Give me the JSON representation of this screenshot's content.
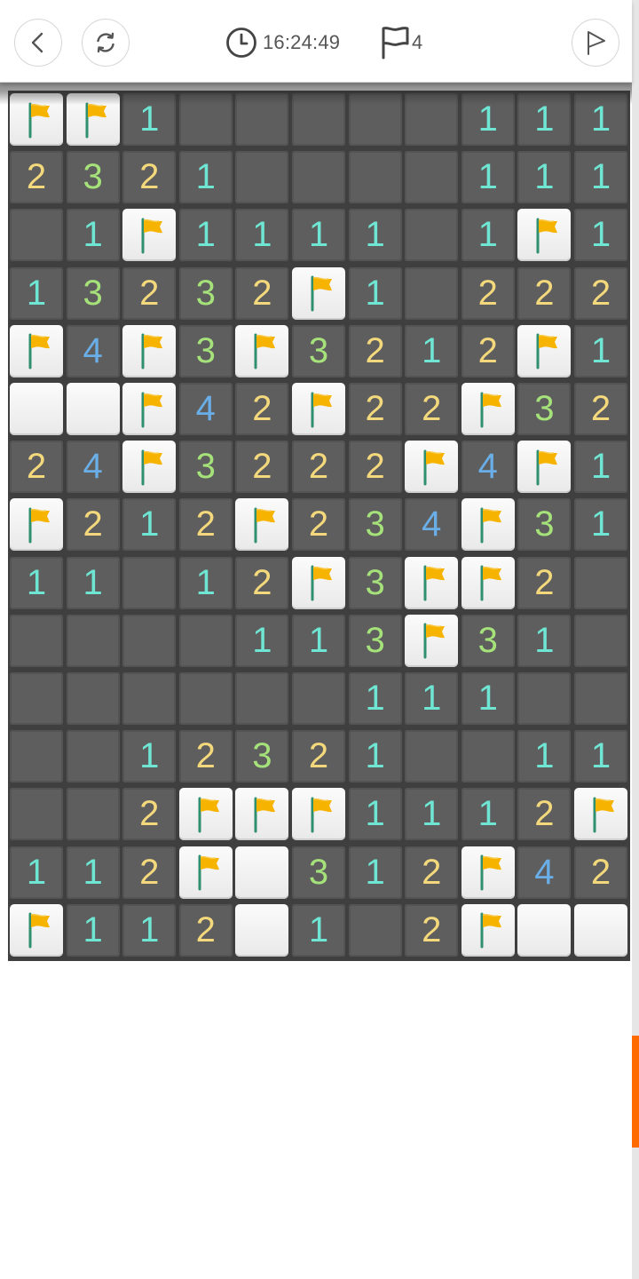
{
  "header": {
    "back_icon": "chevron-left-icon",
    "restart_icon": "refresh-icon",
    "clock_icon": "clock-icon",
    "time": "16:24:49",
    "flag_icon": "flag-outline-icon",
    "flag_count": "4",
    "flag_button_icon": "flag-outline-icon"
  },
  "colors": {
    "open_cell": "#5e5e5e",
    "grid": "#3f3f3f",
    "closed_cell": "#f2f2f2",
    "n1": "#6ee6d3",
    "n2": "#f3d87c",
    "n3": "#a6e27a",
    "n4": "#6aaee8",
    "flag": "#f6b400",
    "scroll_thumb": "#ff6a00"
  },
  "board": {
    "cols": 11,
    "rows": 15,
    "legend": "F = flagged, C = covered, . = open empty, digit = open number",
    "grid": [
      [
        "F",
        "F",
        "1",
        ".",
        ".",
        ".",
        ".",
        ".",
        "1",
        "1",
        "1"
      ],
      [
        "2",
        "3",
        "2",
        "1",
        ".",
        ".",
        ".",
        ".",
        "1",
        "1",
        "1"
      ],
      [
        ".",
        "1",
        "F",
        "1",
        "1",
        "1",
        "1",
        ".",
        "1",
        "F",
        "1"
      ],
      [
        "1",
        "3",
        "2",
        "3",
        "2",
        "F",
        "1",
        ".",
        "2",
        "2",
        "2"
      ],
      [
        "F",
        "4",
        "F",
        "3",
        "F",
        "3",
        "2",
        "1",
        "2",
        "F",
        "1"
      ],
      [
        "C",
        "C",
        "F",
        "4",
        "2",
        "F",
        "2",
        "2",
        "F",
        "3",
        "2"
      ],
      [
        "2",
        "4",
        "F",
        "3",
        "2",
        "2",
        "2",
        "F",
        "4",
        "F",
        "1"
      ],
      [
        "F",
        "2",
        "1",
        "2",
        "F",
        "2",
        "3",
        "4",
        "F",
        "3",
        "1"
      ],
      [
        "1",
        "1",
        ".",
        "1",
        "2",
        "F",
        "3",
        "F",
        "F",
        "2",
        "."
      ],
      [
        ".",
        ".",
        ".",
        ".",
        "1",
        "1",
        "3",
        "F",
        "3",
        "1",
        "."
      ],
      [
        ".",
        ".",
        ".",
        ".",
        ".",
        ".",
        "1",
        "1",
        "1",
        ".",
        "."
      ],
      [
        ".",
        ".",
        "1",
        "2",
        "3",
        "2",
        "1",
        ".",
        ".",
        "1",
        "1"
      ],
      [
        ".",
        ".",
        "2",
        "F",
        "F",
        "F",
        "1",
        "1",
        "1",
        "2",
        "F"
      ],
      [
        "1",
        "1",
        "2",
        "F",
        "C",
        "3",
        "1",
        "2",
        "F",
        "4",
        "2"
      ],
      [
        "F",
        "1",
        "1",
        "2",
        "C",
        "1",
        ".",
        "2",
        "F",
        "C",
        "C"
      ]
    ]
  }
}
